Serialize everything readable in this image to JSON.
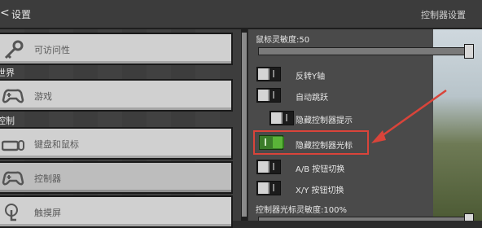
{
  "header": {
    "close_glyph": "<",
    "title": "设置",
    "right_title": "控制器设置"
  },
  "sidebar": {
    "items": [
      {
        "label": "可访问性",
        "icon": "key-icon",
        "section": null
      },
      {
        "label": "游戏",
        "icon": "controller-icon",
        "section": "世界"
      },
      {
        "label": "键盘和鼠标",
        "icon": "keyboard-mouse-icon",
        "section": "控制"
      },
      {
        "label": "控制器",
        "icon": "controller-icon",
        "selected": true
      },
      {
        "label": "触摸屏",
        "icon": "touch-icon"
      }
    ],
    "section_world": "世界",
    "section_control": "控制"
  },
  "panel": {
    "sensitivity_label": "鼠标灵敏度:50",
    "sensitivity_value": 50,
    "toggles": [
      {
        "label": "反转Y轴",
        "on": false
      },
      {
        "label": "自动跳跃",
        "on": false
      },
      {
        "label": "隐藏控制器提示",
        "on": false
      },
      {
        "label": "隐藏控制器光标",
        "on": true
      },
      {
        "label": "A/B 按钮切换",
        "on": false
      },
      {
        "label": "X/Y 按钮切换",
        "on": false
      }
    ],
    "cursor_sensitivity_label": "控制器光标灵敏度:100%",
    "cursor_sensitivity_value": 100
  },
  "colors": {
    "highlight": "#d9443a",
    "toggle_on": "#5ab438"
  }
}
